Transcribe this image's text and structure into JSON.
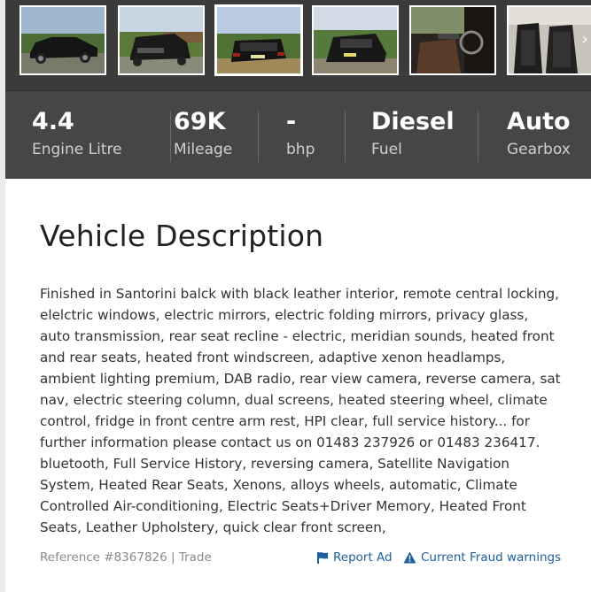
{
  "gallery": {
    "thumbnails": [
      {
        "alt": "car-front-left"
      },
      {
        "alt": "car-front"
      },
      {
        "alt": "car-rear",
        "selected": true
      },
      {
        "alt": "car-rear-right"
      },
      {
        "alt": "interior-front"
      },
      {
        "alt": "interior-seats"
      }
    ],
    "next_icon": "chevron-right"
  },
  "specs": [
    {
      "value": "4.4",
      "label": "Engine Litre"
    },
    {
      "value": "69K",
      "label": "Mileage"
    },
    {
      "value": "-",
      "label": "bhp"
    },
    {
      "value": "Diesel",
      "label": "Fuel"
    },
    {
      "value": "Auto",
      "label": "Gearbox"
    }
  ],
  "description": {
    "title": "Vehicle Description",
    "body": "Finished in Santorini balck with black leather interior, remote central locking, elelctric windows, electric mirrors, electric folding mirrors, privacy glass, auto transmission, rear seat recline - electric,  meridian sounds, heated front and rear seats, heated front windscreen, adaptive xenon headlamps, ambient lighting premium, DAB radio, rear view camera,  reverse camera, sat nav, electric steering column, dual screens, heated steering wheel, climate control, fridge in front centre arm rest, HPI clear, full service history... for further information please contact us on 01483 237926 or 01483 236417. bluetooth, Full Service History, reversing camera, Satellite Navigation System, Heated Rear Seats, Xenons, alloys wheels, automatic, Climate Controlled Air-conditioning, Electric Seats+Driver Memory, Heated Front Seats, Leather Upholstery, quick clear front screen,"
  },
  "footer": {
    "reference": "Reference #8367826 | Trade",
    "report_label": "Report Ad",
    "fraud_label": "Current Fraud warnings"
  },
  "colors": {
    "link": "#1d5f9e",
    "specs_bg": "#464646",
    "gallery_bg": "#3b3b3b"
  }
}
